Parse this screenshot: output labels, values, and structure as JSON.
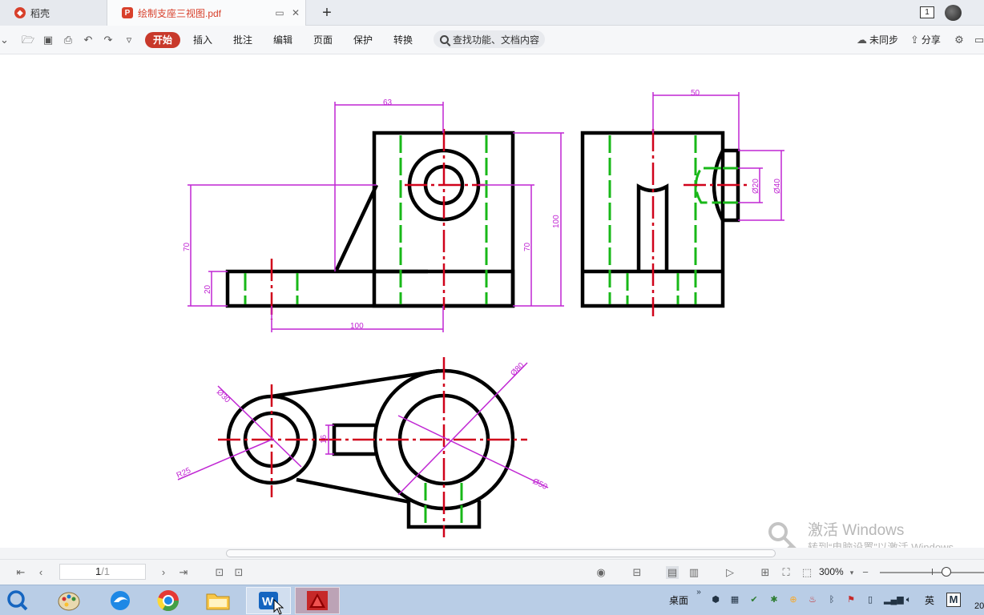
{
  "tabs": [
    {
      "label": "稻壳",
      "icon": "docer-icon"
    },
    {
      "label": "绘制支座三视图.pdf",
      "icon": "pdf-icon",
      "active": true
    }
  ],
  "window": {
    "badge": "1"
  },
  "toolbar": {
    "menus": [
      "开始",
      "插入",
      "批注",
      "编辑",
      "页面",
      "保护",
      "转换"
    ],
    "search_label": "查找功能、文档内容",
    "sync_label": "未同步",
    "share_label": "分享"
  },
  "drawing": {
    "dims": {
      "d63": "63",
      "d50": "50",
      "d100_right": "100",
      "d70_left": "70",
      "d70_mid": "70",
      "d20": "20",
      "d100_bottom": "100",
      "d20_phi": "Ø20",
      "d40_phi": "Ø40",
      "d30_phi": "Ø30",
      "d80_phi": "Ø80",
      "d50_phi": "Ø50",
      "r25": "R25",
      "d16": "16"
    },
    "colors": {
      "outline": "#000000",
      "center": "#d0021b",
      "hidden": "#18b818",
      "dimension": "#c026d3"
    }
  },
  "watermark": {
    "line1": "激活 Windows",
    "line2": "转到“电脑设置”以激活 Windows。"
  },
  "status": {
    "page_current": "1",
    "page_total": "/1",
    "zoom": "300%"
  },
  "taskbar": {
    "desktop_label": "桌面",
    "ime_label": "英",
    "clock_fragment": "20"
  }
}
